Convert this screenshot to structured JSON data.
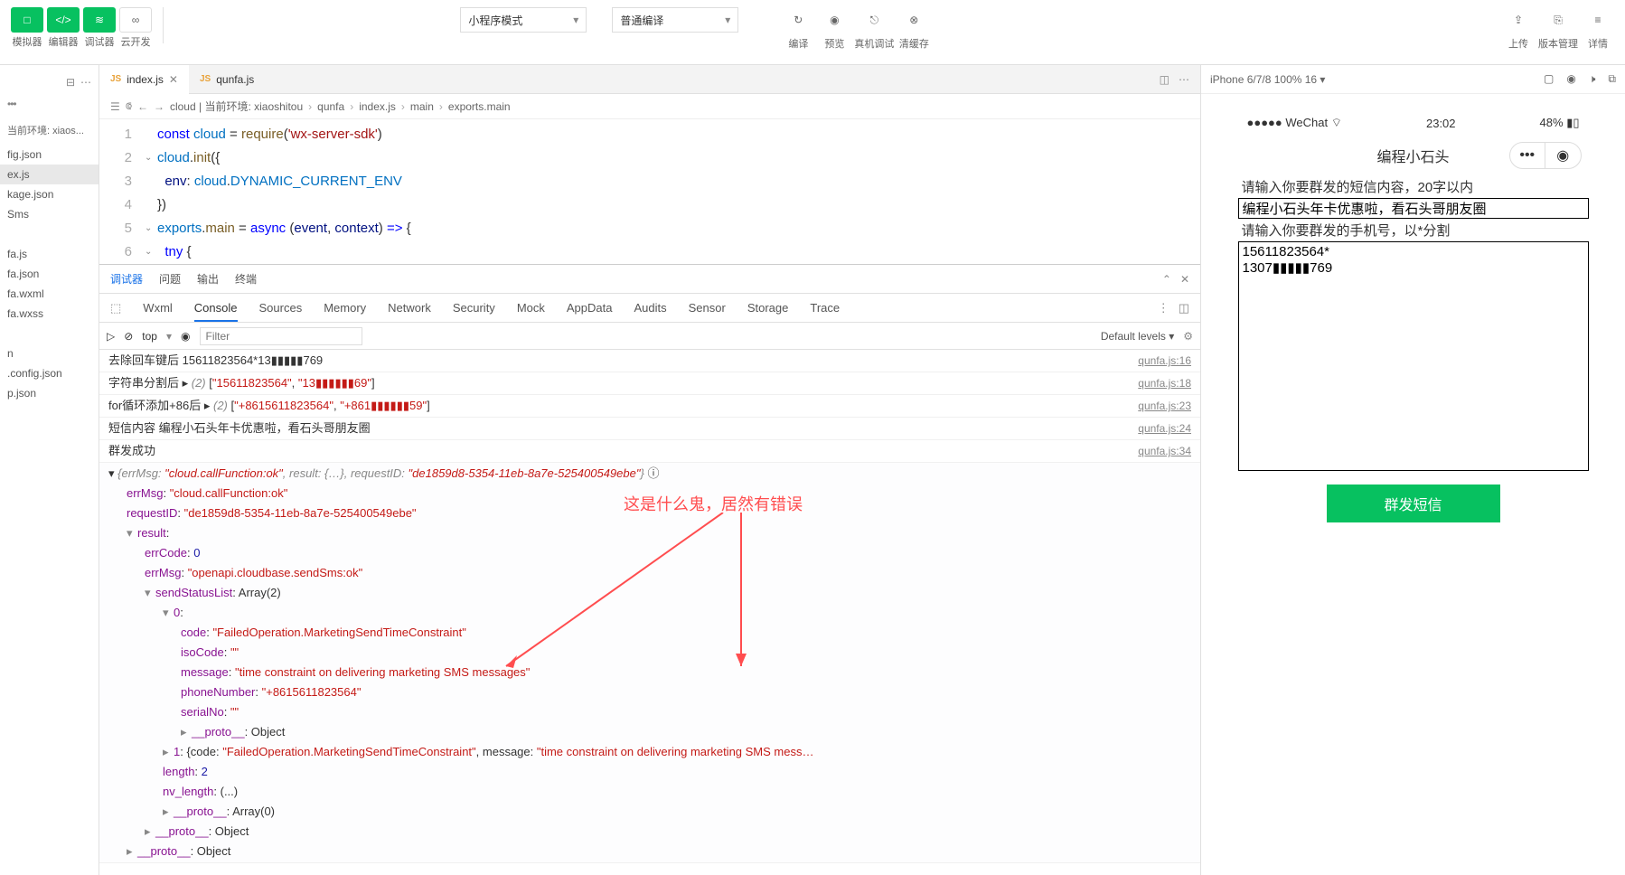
{
  "toolbar": {
    "groups": [
      {
        "btns": [
          "□",
          "</>",
          "≋"
        ],
        "labels": [
          "模拟器",
          "编辑器",
          "调试器"
        ],
        "green": true
      },
      {
        "btns": [
          "∞"
        ],
        "labels": [
          "云开发"
        ],
        "green": false
      }
    ],
    "select1": "小程序模式",
    "select2": "普通编译",
    "actions": [
      {
        "icon": "↻",
        "label": "编译"
      },
      {
        "icon": "◉",
        "label": "预览"
      },
      {
        "icon": "⎋",
        "label": "真机调试"
      },
      {
        "icon": "⊗",
        "label": "清缓存"
      }
    ],
    "right": [
      {
        "icon": "⇪",
        "label": "上传"
      },
      {
        "icon": "⎘",
        "label": "版本管理"
      },
      {
        "icon": "≡",
        "label": "详情"
      }
    ]
  },
  "tree": {
    "env_label": "当前环境: xiaos...",
    "items": [
      "fig.json",
      "ex.js",
      "kage.json",
      "Sms",
      "",
      "fa.js",
      "fa.json",
      "fa.wxml",
      "fa.wxss",
      "",
      "n",
      ".config.json",
      "p.json"
    ]
  },
  "tabs": [
    {
      "name": "index.js",
      "icon": "JS",
      "active": true
    },
    {
      "name": "qunfa.js",
      "icon": "JS",
      "active": false
    }
  ],
  "breadcrumb": [
    "cloud | 当前环境: xiaoshitou",
    "qunfa",
    "index.js",
    "main",
    "exports.main"
  ],
  "code": [
    {
      "n": 1,
      "fold": "",
      "html": "<span class='kw'>const</span> <span class='const-c'>cloud</span> = <span class='fn'>require</span>(<span class='str'>'wx-server-sdk'</span>)"
    },
    {
      "n": 2,
      "fold": "⌄",
      "html": "<span class='const-c'>cloud</span>.<span class='fn'>init</span>({"
    },
    {
      "n": 3,
      "fold": "",
      "html": "  <span class='prop'>env</span>: <span class='const-c'>cloud</span>.<span class='const-c'>DYNAMIC_CURRENT_ENV</span>"
    },
    {
      "n": 4,
      "fold": "",
      "html": "})"
    },
    {
      "n": 5,
      "fold": "⌄",
      "html": "<span class='const-c'>exports</span>.<span class='fn'>main</span> = <span class='kw'>async</span> (<span class='prop'>event</span>, <span class='prop'>context</span>) <span class='kw'>=&gt;</span> {"
    },
    {
      "n": 6,
      "fold": "⌄",
      "html": "  <span class='kw'>tny</span> <span>{</span>"
    }
  ],
  "debug_tabs": [
    "调试器",
    "问题",
    "输出",
    "终端"
  ],
  "devtools_tabs": [
    "Wxml",
    "Console",
    "Sources",
    "Memory",
    "Network",
    "Security",
    "Mock",
    "AppData",
    "Audits",
    "Sensor",
    "Storage",
    "Trace"
  ],
  "devtools_active": "Console",
  "console_bar": {
    "context": "top",
    "filter_ph": "Filter",
    "levels": "Default levels ▾"
  },
  "logs": [
    {
      "msg": "去除回车键后 15611823564*13▮▮▮▮▮769",
      "src": "qunfa.js:16"
    },
    {
      "msg": "字符串分割后 ▸ <span class='obj-gray'>(2)</span> [<span class='obj-red'>\"15611823564\"</span>, <span class='obj-red'>\"13▮▮▮▮▮▮69\"</span>]",
      "src": "qunfa.js:18"
    },
    {
      "msg": "for循环添加+86后 ▸ <span class='obj-gray'>(2)</span> [<span class='obj-red'>\"+8615611823564\"</span>, <span class='obj-red'>\"+861▮▮▮▮▮▮59\"</span>]",
      "src": "qunfa.js:23"
    },
    {
      "msg": "短信内容 编程小石头年卡优惠啦，看石头哥朋友圈",
      "src": "qunfa.js:24"
    },
    {
      "msg": "群发成功",
      "src": "qunfa.js:34"
    }
  ],
  "expanded": {
    "summary": "▾ <span class='obj-gray'>{errMsg: <span class='obj-red'>\"cloud.callFunction:ok\"</span>, result: {…}, requestID: <span class='obj-red'>\"de1859d8-5354-11eb-8a7e-525400549ebe\"</span>}</span> ⓘ",
    "lines": [
      {
        "i": 1,
        "t": "<span class='obj-purple'>errMsg</span>: <span class='obj-red'>\"cloud.callFunction:ok\"</span>"
      },
      {
        "i": 1,
        "t": "<span class='obj-purple'>requestID</span>: <span class='obj-red'>\"de1859d8-5354-11eb-8a7e-525400549ebe\"</span>"
      },
      {
        "i": 1,
        "t": "<span class='caret'>▾</span><span class='obj-purple'>result</span>:"
      },
      {
        "i": 2,
        "t": "<span class='obj-purple'>errCode</span>: <span class='obj-blue'>0</span>"
      },
      {
        "i": 2,
        "t": "<span class='obj-purple'>errMsg</span>: <span class='obj-red'>\"openapi.cloudbase.sendSms:ok\"</span>"
      },
      {
        "i": 2,
        "t": "<span class='caret'>▾</span><span class='obj-purple'>sendStatusList</span>: Array(2)"
      },
      {
        "i": 3,
        "t": "<span class='caret'>▾</span><span class='obj-purple'>0</span>:"
      },
      {
        "i": 4,
        "t": "<span class='obj-purple'>code</span>: <span class='obj-red'>\"FailedOperation.MarketingSendTimeConstraint\"</span>"
      },
      {
        "i": 4,
        "t": "<span class='obj-purple'>isoCode</span>: <span class='obj-red'>\"\"</span>"
      },
      {
        "i": 4,
        "t": "<span class='obj-purple'>message</span>: <span class='obj-red'>\"time constraint on delivering marketing SMS messages\"</span>"
      },
      {
        "i": 4,
        "t": "<span class='obj-purple'>phoneNumber</span>: <span class='obj-red'>\"+8615611823564\"</span>"
      },
      {
        "i": 4,
        "t": "<span class='obj-purple'>serialNo</span>: <span class='obj-red'>\"\"</span>"
      },
      {
        "i": 4,
        "t": "<span class='caret'>▸</span><span class='obj-purple'>__proto__</span>: Object"
      },
      {
        "i": 3,
        "t": "<span class='caret'>▸</span><span class='obj-purple'>1</span>: {code: <span class='obj-red'>\"FailedOperation.MarketingSendTimeConstraint\"</span>, message: <span class='obj-red'>\"time constraint on delivering marketing SMS mess…</span>"
      },
      {
        "i": 3,
        "t": "<span class='obj-purple'>length</span>: <span class='obj-blue'>2</span>"
      },
      {
        "i": 3,
        "t": "<span class='obj-purple'>nv_length</span>: (...)"
      },
      {
        "i": 3,
        "t": "<span class='caret'>▸</span><span class='obj-purple'>__proto__</span>: Array(0)"
      },
      {
        "i": 2,
        "t": "<span class='caret'>▸</span><span class='obj-purple'>__proto__</span>: Object"
      },
      {
        "i": 1,
        "t": "<span class='caret'>▸</span><span class='obj-purple'>__proto__</span>: Object"
      }
    ]
  },
  "annotation": "这是什么鬼，居然有错误",
  "simulator": {
    "device": "iPhone 6/7/8 100% 16 ▾",
    "status": {
      "carrier": "●●●●● WeChat",
      "wifi": "⌔",
      "time": "23:02",
      "battery": "48%"
    },
    "nav_title": "编程小石头",
    "label1": "请输入你要群发的短信内容，20字以内",
    "input1": "编程小石头年卡优惠啦，看石头哥朋友圈",
    "label2": "请输入你要群发的手机号，以*分割",
    "textarea": "15611823564*\n1307▮▮▮▮▮769",
    "button": "群发短信"
  }
}
